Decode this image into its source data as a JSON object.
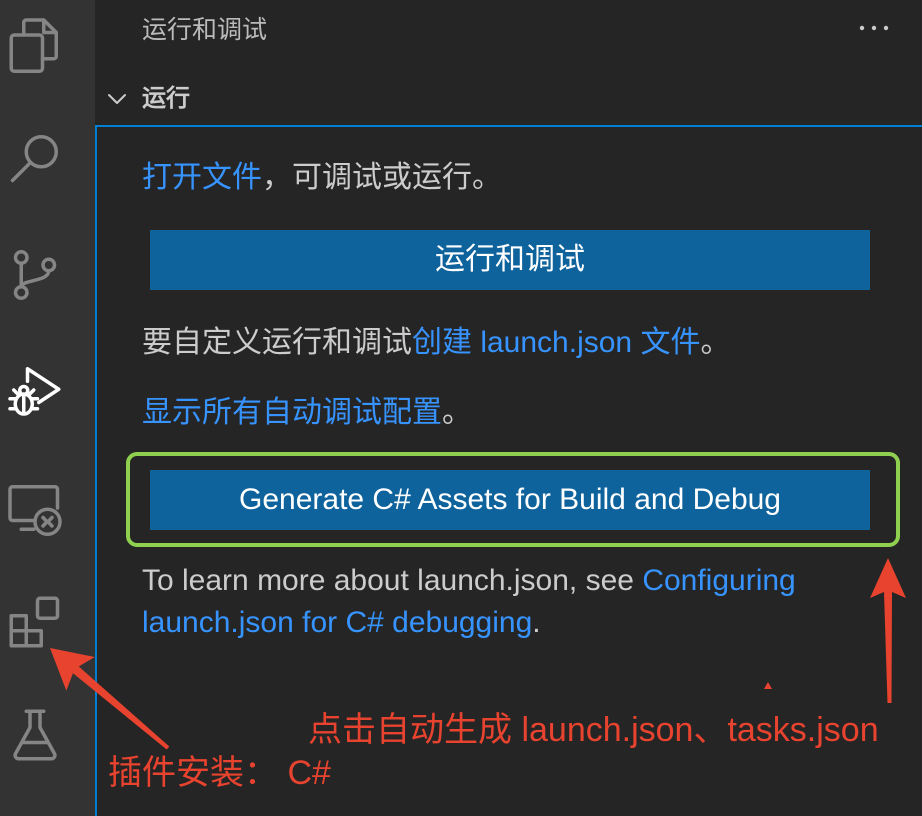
{
  "activity_bar": {
    "items": [
      {
        "icon": "files-icon",
        "active": false
      },
      {
        "icon": "search-icon",
        "active": false
      },
      {
        "icon": "source-control-icon",
        "active": false
      },
      {
        "icon": "run-debug-icon",
        "active": true
      },
      {
        "icon": "remote-explorer-icon",
        "active": false
      },
      {
        "icon": "extensions-icon",
        "active": false
      },
      {
        "icon": "testing-icon",
        "active": false
      }
    ]
  },
  "sidebar": {
    "title": "运行和调试",
    "more_actions_icon": "ellipsis-icon",
    "section": {
      "title": "运行",
      "chevron_icon": "chevron-down-icon"
    }
  },
  "welcome": {
    "open_file": {
      "link": "打开文件",
      "text": "，可调试或运行。"
    },
    "run_and_debug_button": "运行和调试",
    "customize": {
      "prefix": "要自定义运行和调试",
      "link": "创建 launch.json 文件",
      "suffix": "。"
    },
    "show_all": {
      "link": "显示所有自动调试配置",
      "suffix": "。"
    },
    "generate_assets_button": "Generate C# Assets for Build and Debug",
    "learn_more": {
      "prefix": "To learn more about launch.json, see ",
      "link_line1": "Configuring",
      "link_line2": "launch.json for C# debugging",
      "suffix": "."
    }
  },
  "annotations": {
    "auto_generate_note": "点击自动生成 launch.json、tasks.json",
    "install_plugin_note": "插件安装： C#"
  },
  "colors": {
    "activity_bar_bg": "#333333",
    "sidebar_bg": "#252526",
    "text": "#cccccc",
    "link": "#3794ff",
    "button_bg": "#0e639c",
    "button_text": "#ffffff",
    "focus_border": "#007fd4",
    "annotation_red": "#e8432e",
    "annotation_green": "#8fd14f"
  }
}
